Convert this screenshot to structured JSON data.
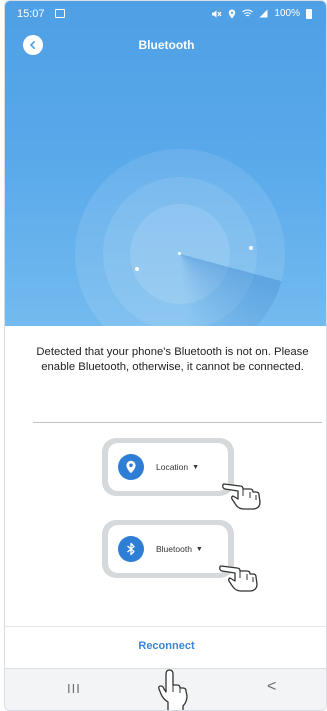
{
  "status_bar": {
    "time": "15:07",
    "battery": "100%"
  },
  "header": {
    "title": "Bluetooth"
  },
  "dialog": {
    "message": "Detected that your phone's Bluetooth is not on. Please enable Bluetooth, otherwise, it cannot be connected.",
    "location_label": "Location",
    "bluetooth_label": "Bluetooth",
    "reconnect_label": "Reconnect"
  },
  "icons": {
    "back": "back-icon",
    "location": "location-pin-icon",
    "bluetooth": "bluetooth-icon",
    "hand": "pointing-hand-icon",
    "recents": "recents-icon",
    "system_back": "chevron-left-icon"
  },
  "system_nav": {
    "recents": "III",
    "back": "<"
  },
  "colors": {
    "header_blue": "#58a8ea",
    "accent": "#2e7ed6",
    "link": "#3b86d6"
  }
}
